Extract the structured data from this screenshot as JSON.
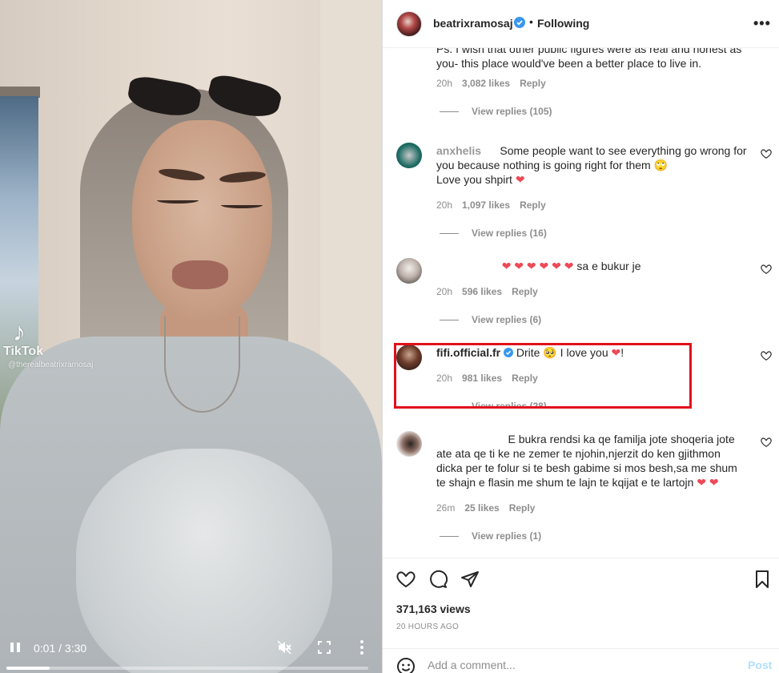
{
  "video": {
    "watermark_name": "TikTok",
    "watermark_handle": "@therealbeatrixramosaj",
    "current_time": "0:01",
    "time_separator": " / ",
    "duration": "3:30",
    "progress_fraction": 0.12
  },
  "header": {
    "username": "beatrixramosaj",
    "separator": "•",
    "follow_label": "Following",
    "more_label": "•••"
  },
  "comments": [
    {
      "text": "Ps. I wish that other public figures were as real and honest as you- this place would've been a better place to live in.",
      "time": "20h",
      "likes": "3,082 likes",
      "reply": "Reply",
      "view_replies": "View replies (105)"
    },
    {
      "user": "anxhelis",
      "text": "Some people want to see everything go wrong for you because nothing is going right for them 🙄",
      "text2": "Love you shpirt",
      "time": "20h",
      "likes": "1,097 likes",
      "reply": "Reply",
      "view_replies": "View replies (16)"
    },
    {
      "user": "",
      "text": "❤ ❤ ❤ ❤ ❤ ❤",
      "text2": "sa e bukur je",
      "time": "20h",
      "likes": "596 likes",
      "reply": "Reply",
      "view_replies": "View replies (6)"
    },
    {
      "user": "fifi.official.fr",
      "text": "Drite 🥺 I love you",
      "text2": "!",
      "time": "20h",
      "likes": "981 likes",
      "reply": "Reply",
      "view_replies": "View replies (28)"
    },
    {
      "user": "",
      "text": "E bukra rendsi ka qe familja jote shoqeria jote ate ata qe ti ke ne zemer te njohin,njerzit do ken gjithmon dicka per te folur si te besh gabime si mos besh,sa me shum te shajn e flasin me shum te lajn te kqijat e te lartojn",
      "time": "26m",
      "likes": "25 likes",
      "reply": "Reply",
      "view_replies": "View replies (1)"
    }
  ],
  "stats": {
    "views": "371,163 views",
    "date": "20 HOURS AGO"
  },
  "composer": {
    "placeholder": "Add a comment...",
    "post_label": "Post"
  },
  "colors": {
    "highlight_box": "#e0111b",
    "verified_blue": "#3897f0",
    "heart_red": "#ed4956",
    "post_disabled": "#b2dffc"
  },
  "icons": [
    "play-pause-icon",
    "mute-icon",
    "fullscreen-icon",
    "more-vertical-icon",
    "verified-icon",
    "like-heart-icon",
    "comment-icon",
    "share-icon",
    "save-bookmark-icon",
    "emoji-icon"
  ]
}
